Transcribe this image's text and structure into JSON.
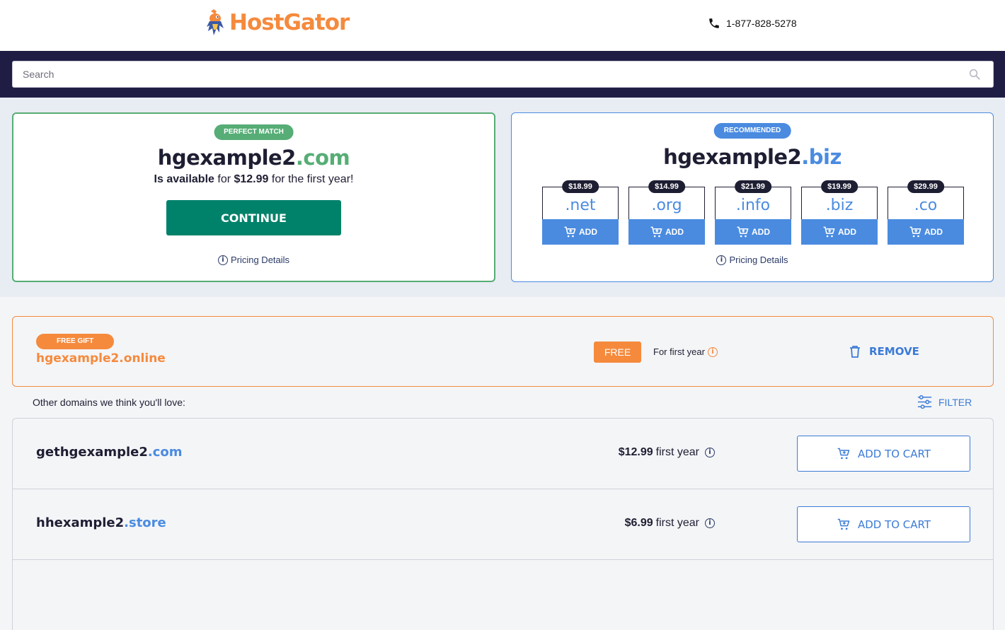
{
  "header": {
    "logo_text": "HostGator",
    "phone": "1-877-828-5278"
  },
  "search": {
    "placeholder": "Search"
  },
  "perfect_match": {
    "badge": "PERFECT MATCH",
    "domain_name": "hgexample2",
    "domain_tld": ".com",
    "availability_bold": "Is available",
    "availability_mid": " for ",
    "price": "$12.99",
    "availability_end": " for the first year!",
    "continue_label": "CONTINUE",
    "pricing_details": "Pricing Details"
  },
  "recommended": {
    "badge": "RECOMMENDED",
    "domain_name": "hgexample2",
    "domain_tld": ".biz",
    "pricing_details": "Pricing Details",
    "add_label": "ADD",
    "tlds": [
      {
        "price": "$18.99",
        "tld": ".net"
      },
      {
        "price": "$14.99",
        "tld": ".org"
      },
      {
        "price": "$21.99",
        "tld": ".info"
      },
      {
        "price": "$19.99",
        "tld": ".biz"
      },
      {
        "price": "$29.99",
        "tld": ".co"
      }
    ]
  },
  "free_gift": {
    "badge": "FREE GIFT",
    "domain": "hgexample2.online",
    "free_label": "FREE",
    "term": "For first year",
    "remove_label": "REMOVE"
  },
  "other": {
    "label": "Other domains we think you'll love:",
    "filter_label": "FILTER",
    "rows": [
      {
        "name": "gethgexample2",
        "tld": ".com",
        "price": "$12.99",
        "term": " first year",
        "cart_label": "ADD TO CART"
      },
      {
        "name": "hhexample2",
        "tld": ".store",
        "price": "$6.99",
        "term": " first year",
        "cart_label": "ADD TO CART"
      }
    ]
  },
  "colors": {
    "brand_orange": "#f58a3d",
    "navy": "#201d45",
    "green": "#56ad75",
    "continue_green": "#00826a",
    "blue": "#4a8be0"
  }
}
